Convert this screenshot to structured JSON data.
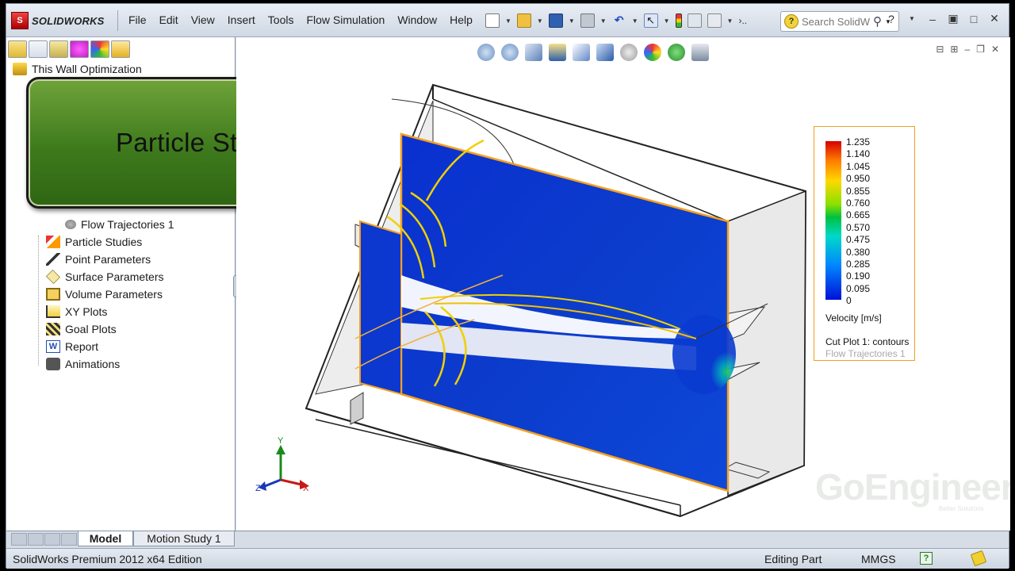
{
  "app": {
    "logo_text": "SOLIDWORKS",
    "menu": [
      "File",
      "Edit",
      "View",
      "Insert",
      "Tools",
      "Flow Simulation",
      "Window",
      "Help"
    ],
    "search_placeholder": "Search SolidW"
  },
  "tree": {
    "root": "This Wall Optimization",
    "items": [
      {
        "label": "Flow Trajectories 1",
        "icon": "trajectory-icon"
      },
      {
        "label": "Particle Studies",
        "icon": "particle-icon"
      },
      {
        "label": "Point Parameters",
        "icon": "probe-icon"
      },
      {
        "label": "Surface Parameters",
        "icon": "surface-icon"
      },
      {
        "label": "Volume Parameters",
        "icon": "volume-icon"
      },
      {
        "label": "XY Plots",
        "icon": "xy-plot-icon"
      },
      {
        "label": "Goal Plots",
        "icon": "goal-plot-icon"
      },
      {
        "label": "Report",
        "icon": "report-icon"
      },
      {
        "label": "Animations",
        "icon": "animation-icon"
      }
    ]
  },
  "callout": {
    "text": "Particle Studies"
  },
  "bottom_tabs": {
    "model": "Model",
    "motion": "Motion Study 1"
  },
  "status": {
    "left": "SolidWorks Premium 2012 x64 Edition",
    "editing": "Editing Part",
    "units": "MMGS"
  },
  "legend": {
    "ticks": [
      "1.235",
      "1.140",
      "1.045",
      "0.950",
      "0.855",
      "0.760",
      "0.665",
      "0.570",
      "0.475",
      "0.380",
      "0.285",
      "0.190",
      "0.095",
      "0"
    ],
    "unit": "Velocity [m/s]",
    "cut_plot": "Cut Plot 1: contours",
    "trajectories": "Flow Trajectories 1"
  },
  "watermark": {
    "text": "GoEngineer",
    "sub": "Better Solutions"
  },
  "colors": {
    "callout_green": "#3e7a1c",
    "legend_border": "#f0a020",
    "accent_blue": "#0018c8"
  }
}
